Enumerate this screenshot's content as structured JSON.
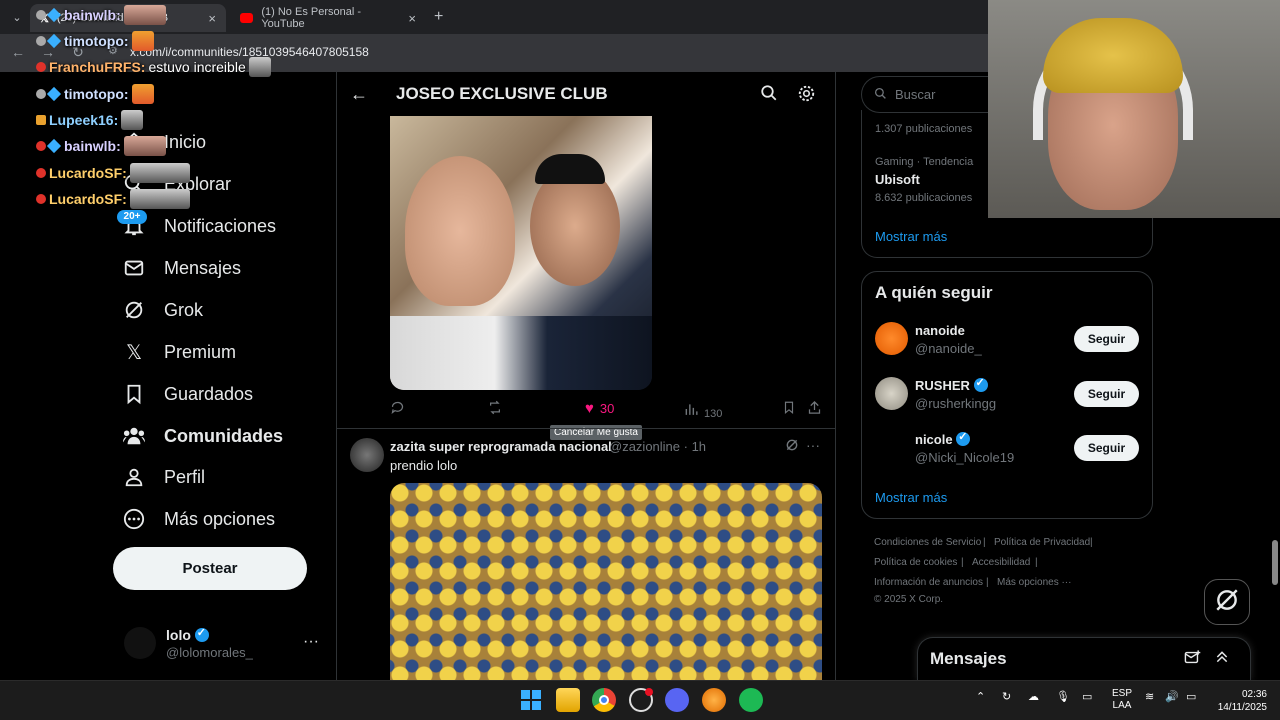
{
  "browser": {
    "tabs": [
      {
        "label": "(20) Comunidad CLUB",
        "active": true
      },
      {
        "label": "(1) No Es Personal - YouTube",
        "active": false
      }
    ],
    "url": "x.com/i/communities/1851039546407805158",
    "new_tab": "+",
    "tab_close": "×"
  },
  "chat": [
    {
      "user": "bainwlb:",
      "message": ""
    },
    {
      "user": "timotopo:",
      "message": ""
    },
    {
      "user": "FranchuFRFS:",
      "message": "estuvo increible"
    },
    {
      "user": "timotopo:",
      "message": ""
    },
    {
      "user": "Lupeek16:",
      "message": ""
    },
    {
      "user": "bainwlb:",
      "message": ""
    },
    {
      "user": "LucardoSF:",
      "message": ""
    },
    {
      "user": "LucardoSF:",
      "message": ""
    }
  ],
  "nav": {
    "badge": "20+",
    "items": [
      {
        "label": "Inicio"
      },
      {
        "label": "Explorar"
      },
      {
        "label": "Notificaciones"
      },
      {
        "label": "Mensajes"
      },
      {
        "label": "Grok"
      },
      {
        "label": "Premium"
      },
      {
        "label": "Guardados"
      },
      {
        "label": "Comunidades"
      },
      {
        "label": "Perfil"
      },
      {
        "label": "Más opciones"
      }
    ],
    "post_button": "Postear",
    "profile": {
      "name": "lolo",
      "handle": "@lolomorales_"
    }
  },
  "main": {
    "title": "JOSEO EXCLUSIVE CLUB",
    "post1": {
      "like_count": "30",
      "views": "130",
      "tooltip": "Cancelar Me gusta"
    },
    "post2": {
      "author": "zazita super reprogramada nacional",
      "handle": "@zazionline",
      "time": "· 1h",
      "text": "prendio lolo"
    }
  },
  "right": {
    "search_placeholder": "Buscar",
    "trends": [
      {
        "meta": "1.307 publicaciones"
      },
      {
        "category": "Gaming · Tendencia",
        "title": "Ubisoft",
        "meta": "8.632 publicaciones"
      }
    ],
    "trends_more": "Mostrar más",
    "follow": {
      "title": "A quién seguir",
      "users": [
        {
          "name": "nanoide",
          "handle": "@nanoide_",
          "verified": false,
          "button": "Seguir"
        },
        {
          "name": "RUSHER",
          "handle": "@rusherkingg",
          "verified": true,
          "button": "Seguir"
        },
        {
          "name": "nicole",
          "handle": "@Nicki_Nicole19",
          "verified": true,
          "button": "Seguir"
        }
      ],
      "more": "Mostrar más"
    },
    "footer": {
      "links": [
        "Condiciones de Servicio",
        "Política de Privacidad",
        "Política de cookies",
        "Accesibilidad",
        "Información de anuncios",
        "Más opciones ···"
      ],
      "copyright": "© 2025 X Corp."
    },
    "messages_title": "Mensajes"
  },
  "taskbar": {
    "lang": "ESP",
    "lang2": "LAA",
    "time": "02:36",
    "date": "14/11/2025"
  },
  "colors": {
    "accent": "#1d9bf0",
    "like": "#f91880",
    "background": "#000000"
  }
}
